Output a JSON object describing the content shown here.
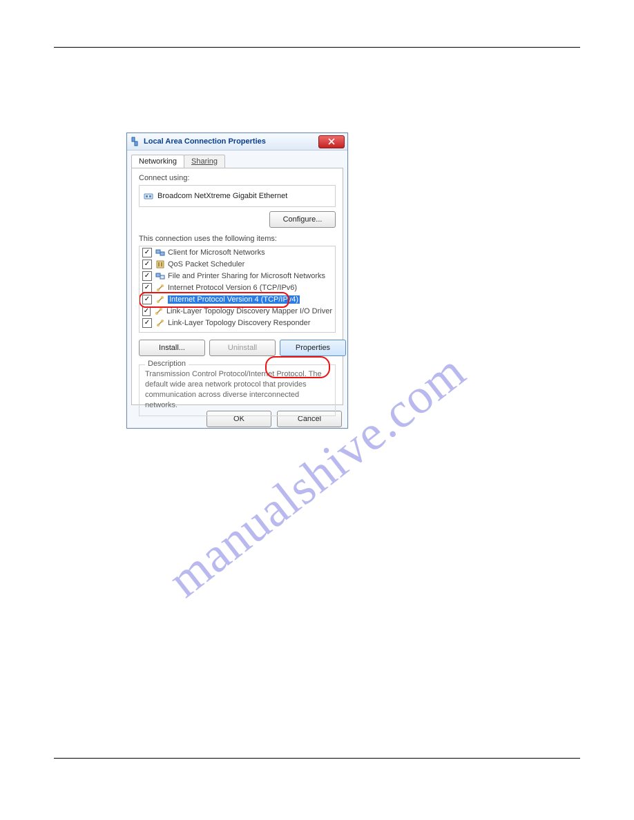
{
  "watermark": "manualshive.com",
  "dialog": {
    "title": "Local Area Connection Properties",
    "tabs": {
      "networking": "Networking",
      "sharing": "Sharing"
    },
    "connect_using_label": "Connect using:",
    "adapter_name": "Broadcom NetXtreme Gigabit Ethernet",
    "configure_button": "Configure...",
    "items_label": "This connection uses the following items:",
    "items": [
      {
        "label": "Client for Microsoft Networks"
      },
      {
        "label": "QoS Packet Scheduler"
      },
      {
        "label": "File and Printer Sharing for Microsoft Networks"
      },
      {
        "label": "Internet Protocol Version 6 (TCP/IPv6)"
      },
      {
        "label": "Internet Protocol Version 4 (TCP/IPv4)"
      },
      {
        "label": "Link-Layer Topology Discovery Mapper I/O Driver"
      },
      {
        "label": "Link-Layer Topology Discovery Responder"
      }
    ],
    "install_button": "Install...",
    "uninstall_button": "Uninstall",
    "properties_button": "Properties",
    "description_legend": "Description",
    "description_text": "Transmission Control Protocol/Internet Protocol. The default wide area network protocol that provides communication across diverse interconnected networks.",
    "ok_button": "OK",
    "cancel_button": "Cancel"
  }
}
